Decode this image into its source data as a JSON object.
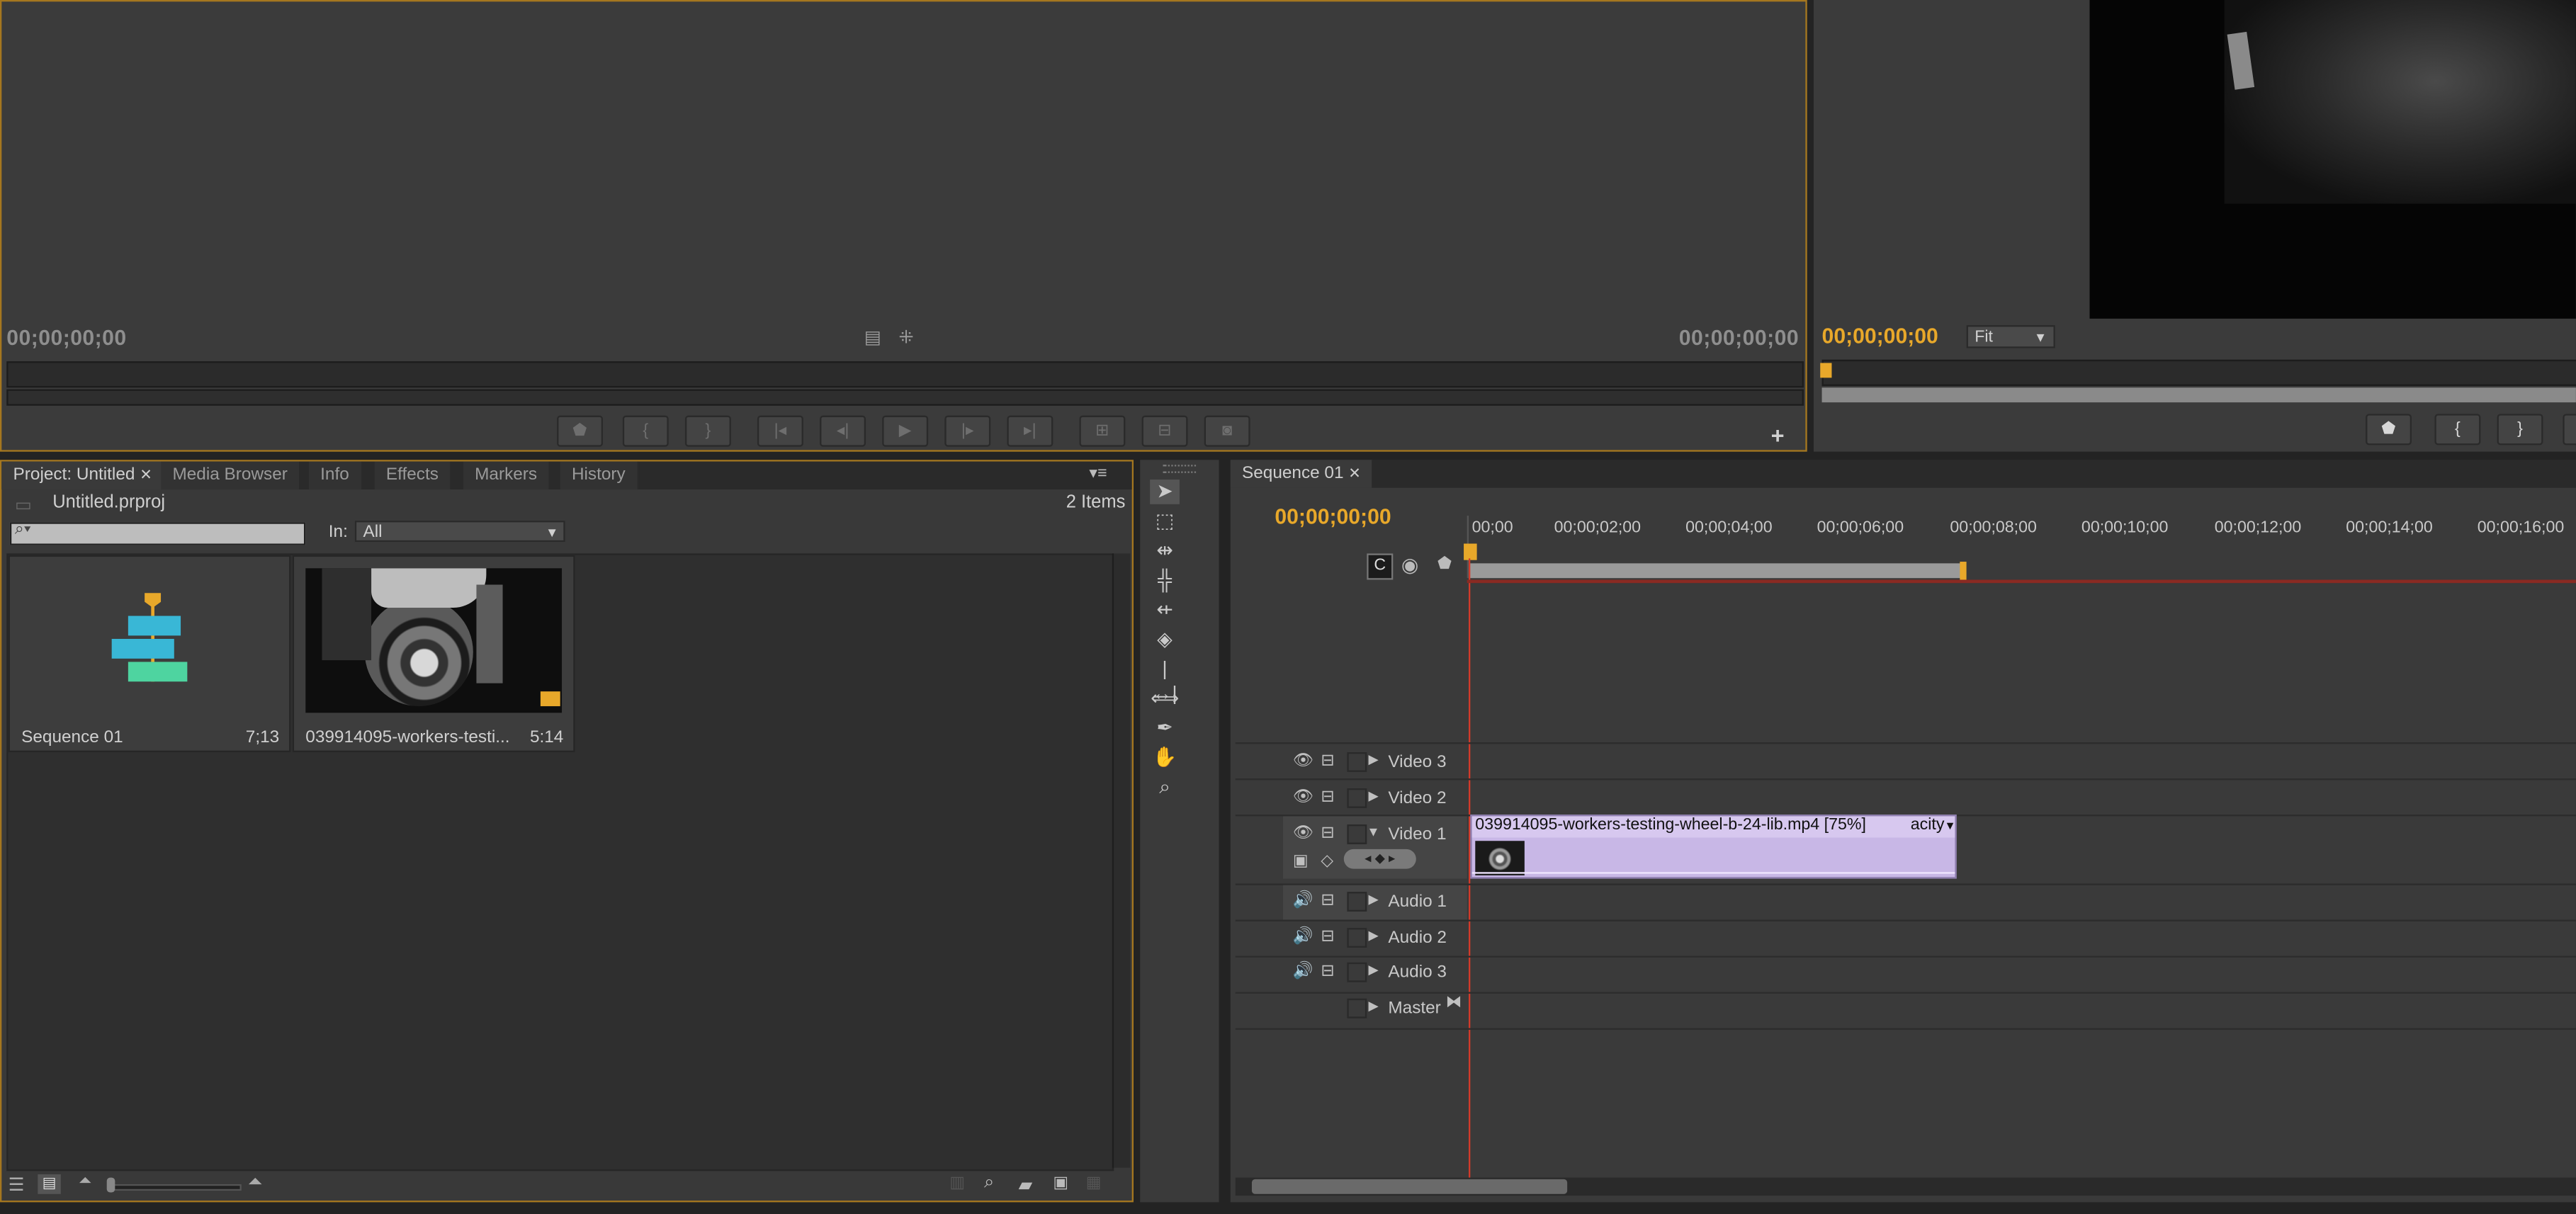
{
  "source_monitor": {
    "timecode_in": "00;00;00;00",
    "timecode_out": "00;00;00;00"
  },
  "program_monitor": {
    "timecode": "00;00;00;00",
    "zoom": "Fit"
  },
  "project_panel": {
    "tabs": [
      "Project: Untitled",
      "Media Browser",
      "Info",
      "Effects",
      "Markers",
      "History"
    ],
    "project_file": "Untitled.prproj",
    "item_count": "2 Items",
    "in_label": "In:",
    "in_value": "All",
    "items": [
      {
        "name": "Sequence 01",
        "duration": "7;13"
      },
      {
        "name": "039914095-workers-testi...",
        "duration": "5:14"
      }
    ]
  },
  "timeline": {
    "tab": "Sequence 01",
    "timecode": "00;00;00;00",
    "ruler": [
      "00;00",
      "00;00;02;00",
      "00;00;04;00",
      "00;00;06;00",
      "00;00;08;00",
      "00;00;10;00",
      "00;00;12;00",
      "00;00;14;00",
      "00;00;16;00"
    ],
    "tracks": {
      "v3": "Video 3",
      "v2": "Video 2",
      "v1": "Video 1",
      "a1": "Audio 1",
      "a2": "Audio 2",
      "a3": "Audio 3",
      "master": "Master"
    },
    "clip_label": "039914095-workers-testing-wheel-b-24-lib.mp4 [75%]",
    "clip_fx": "acity"
  },
  "colors": {
    "accent": "#e8a82a",
    "clip": "#c8b7e6",
    "playhead": "#d43a2a"
  },
  "icons": [
    "marker-icon",
    "in-point-icon",
    "out-point-icon",
    "go-to-in-icon",
    "step-back-icon",
    "play-icon",
    "step-forward-icon",
    "go-to-out-icon",
    "insert-icon",
    "overwrite-icon",
    "camera-icon",
    "plus-icon"
  ]
}
